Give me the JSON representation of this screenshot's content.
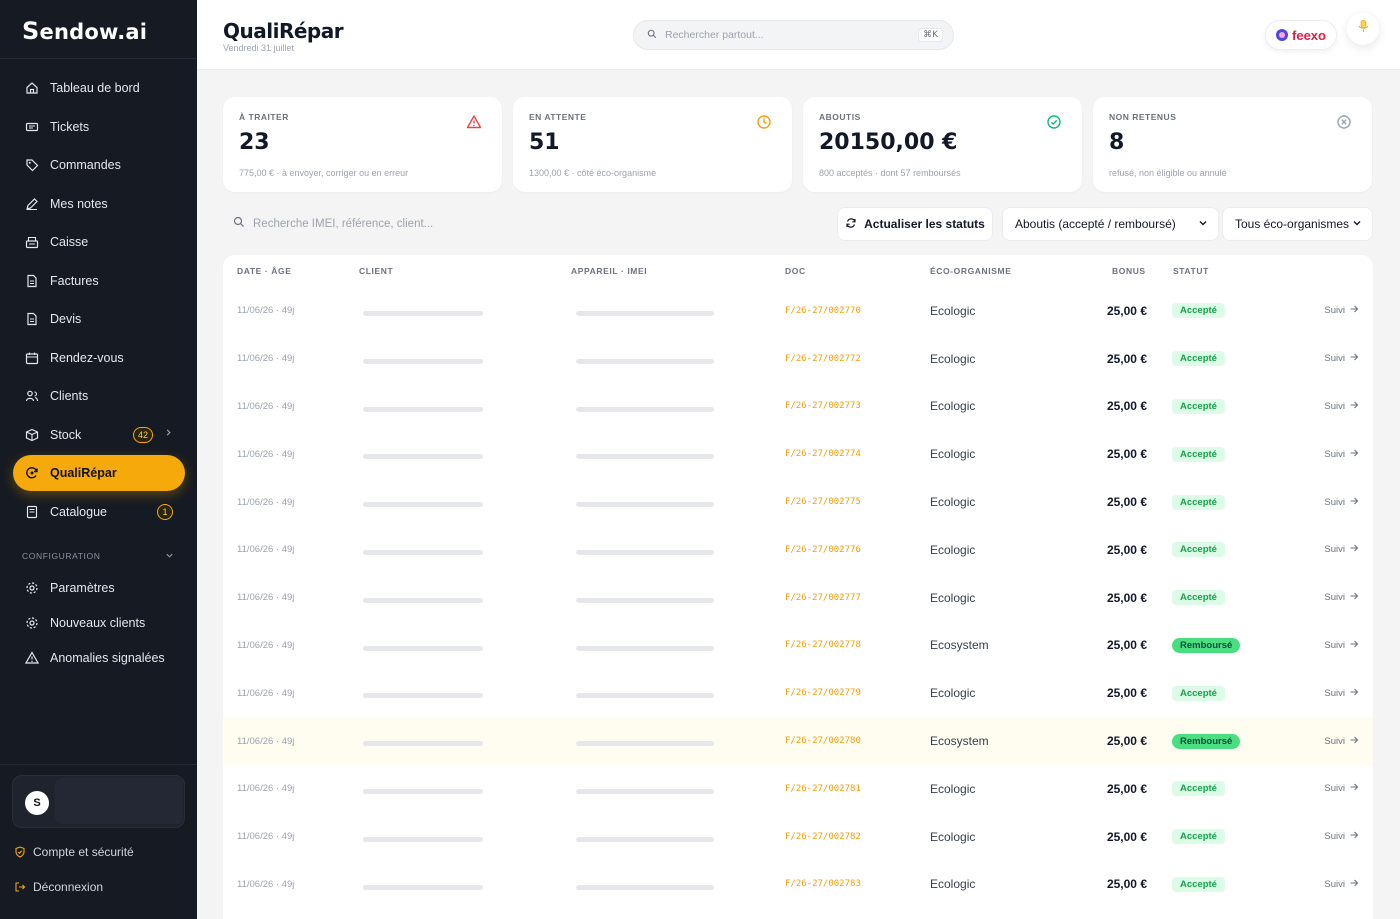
{
  "app": {
    "logo_initial": "S",
    "logo_rest": "endow.ai"
  },
  "sidebar": {
    "items": [
      {
        "label": "Tableau de bord",
        "icon": "home-icon"
      },
      {
        "label": "Tickets",
        "icon": "ticket-icon"
      },
      {
        "label": "Commandes",
        "icon": "tag-icon"
      },
      {
        "label": "Mes notes",
        "icon": "pen-icon"
      },
      {
        "label": "Caisse",
        "icon": "register-icon"
      },
      {
        "label": "Factures",
        "icon": "file-icon"
      },
      {
        "label": "Devis",
        "icon": "file-icon"
      },
      {
        "label": "Rendez-vous",
        "icon": "calendar-icon"
      },
      {
        "label": "Clients",
        "icon": "users-icon"
      },
      {
        "label": "Stock",
        "icon": "box-icon",
        "badge": "42"
      },
      {
        "label": "QualiRépar",
        "icon": "repair-icon",
        "active": true
      },
      {
        "label": "Catalogue",
        "icon": "book-icon",
        "badge": "1"
      }
    ],
    "config_heading": "CONFIGURATION",
    "config_items": [
      {
        "label": "Paramètres",
        "icon": "gear-icon"
      },
      {
        "label": "Nouveaux clients",
        "icon": "gear-icon"
      },
      {
        "label": "Anomalies signalées",
        "icon": "warning-icon"
      }
    ],
    "user_initial": "S",
    "account_label": "Compte et sécurité",
    "logout_label": "Déconnexion"
  },
  "header": {
    "title": "QualiRépar",
    "date": "Vendredi 31 juillet",
    "search_placeholder": "Rechercher partout...",
    "shortcut": "⌘K",
    "feexo_label": "feexo"
  },
  "stats": [
    {
      "label": "À TRAITER",
      "value": "23",
      "sub": "775,00 € · à envoyer, corriger ou en erreur",
      "icon": "alert-triangle-icon",
      "color": "#ef4444"
    },
    {
      "label": "EN ATTENTE",
      "value": "51",
      "sub": "1300,00 € · côté éco-organisme",
      "icon": "clock-icon",
      "color": "#f59e0b"
    },
    {
      "label": "ABOUTIS",
      "value": "20150,00 €",
      "sub": "800 acceptés · dont 57 remboursés",
      "icon": "check-circle-icon",
      "color": "#10b981"
    },
    {
      "label": "NON RETENUS",
      "value": "8",
      "sub": "refusé, non éligible ou annulé",
      "icon": "x-circle-icon",
      "color": "#9ca3af"
    }
  ],
  "toolbar": {
    "search_placeholder": "Recherche IMEI, référence, client...",
    "refresh_label": "Actualiser les statuts",
    "status_filter": "Aboutis (accepté / remboursé)",
    "eco_filter": "Tous éco-organismes"
  },
  "table": {
    "headers": [
      "DATE · ÂGE",
      "CLIENT",
      "APPAREIL · IMEI",
      "DOC",
      "ÉCO-ORGANISME",
      "BONUS",
      "STATUT"
    ],
    "rows": [
      {
        "date": "11/06/26 · 49j",
        "doc": "F/26-27/002770",
        "eco": "Ecologic",
        "bonus": "25,00 €",
        "status": "Accepté",
        "kind": "ok",
        "action": "Suivi"
      },
      {
        "date": "11/06/26 · 49j",
        "doc": "F/26-27/002772",
        "eco": "Ecologic",
        "bonus": "25,00 €",
        "status": "Accepté",
        "kind": "ok",
        "action": "Suivi"
      },
      {
        "date": "11/06/26 · 49j",
        "doc": "F/26-27/002773",
        "eco": "Ecologic",
        "bonus": "25,00 €",
        "status": "Accepté",
        "kind": "ok",
        "action": "Suivi"
      },
      {
        "date": "11/06/26 · 49j",
        "doc": "F/26-27/002774",
        "eco": "Ecologic",
        "bonus": "25,00 €",
        "status": "Accepté",
        "kind": "ok",
        "action": "Suivi"
      },
      {
        "date": "11/06/26 · 49j",
        "doc": "F/26-27/002775",
        "eco": "Ecologic",
        "bonus": "25,00 €",
        "status": "Accepté",
        "kind": "ok",
        "action": "Suivi"
      },
      {
        "date": "11/06/26 · 49j",
        "doc": "F/26-27/002776",
        "eco": "Ecologic",
        "bonus": "25,00 €",
        "status": "Accepté",
        "kind": "ok",
        "action": "Suivi"
      },
      {
        "date": "11/06/26 · 49j",
        "doc": "F/26-27/002777",
        "eco": "Ecologic",
        "bonus": "25,00 €",
        "status": "Accepté",
        "kind": "ok",
        "action": "Suivi"
      },
      {
        "date": "11/06/26 · 49j",
        "doc": "F/26-27/002778",
        "eco": "Ecosystem",
        "bonus": "25,00 €",
        "status": "Remboursé",
        "kind": "remb",
        "action": "Suivi"
      },
      {
        "date": "11/06/26 · 49j",
        "doc": "F/26-27/002779",
        "eco": "Ecologic",
        "bonus": "25,00 €",
        "status": "Accepté",
        "kind": "ok",
        "action": "Suivi"
      },
      {
        "date": "11/06/26 · 49j",
        "doc": "F/26-27/002780",
        "eco": "Ecosystem",
        "bonus": "25,00 €",
        "status": "Remboursé",
        "kind": "remb",
        "action": "Suivi",
        "highlight": true
      },
      {
        "date": "11/06/26 · 49j",
        "doc": "F/26-27/002781",
        "eco": "Ecologic",
        "bonus": "25,00 €",
        "status": "Accepté",
        "kind": "ok",
        "action": "Suivi"
      },
      {
        "date": "11/06/26 · 49j",
        "doc": "F/26-27/002782",
        "eco": "Ecologic",
        "bonus": "25,00 €",
        "status": "Accepté",
        "kind": "ok",
        "action": "Suivi"
      },
      {
        "date": "11/06/26 · 49j",
        "doc": "F/26-27/002783",
        "eco": "Ecologic",
        "bonus": "25,00 €",
        "status": "Accepté",
        "kind": "ok",
        "action": "Suivi"
      }
    ]
  }
}
